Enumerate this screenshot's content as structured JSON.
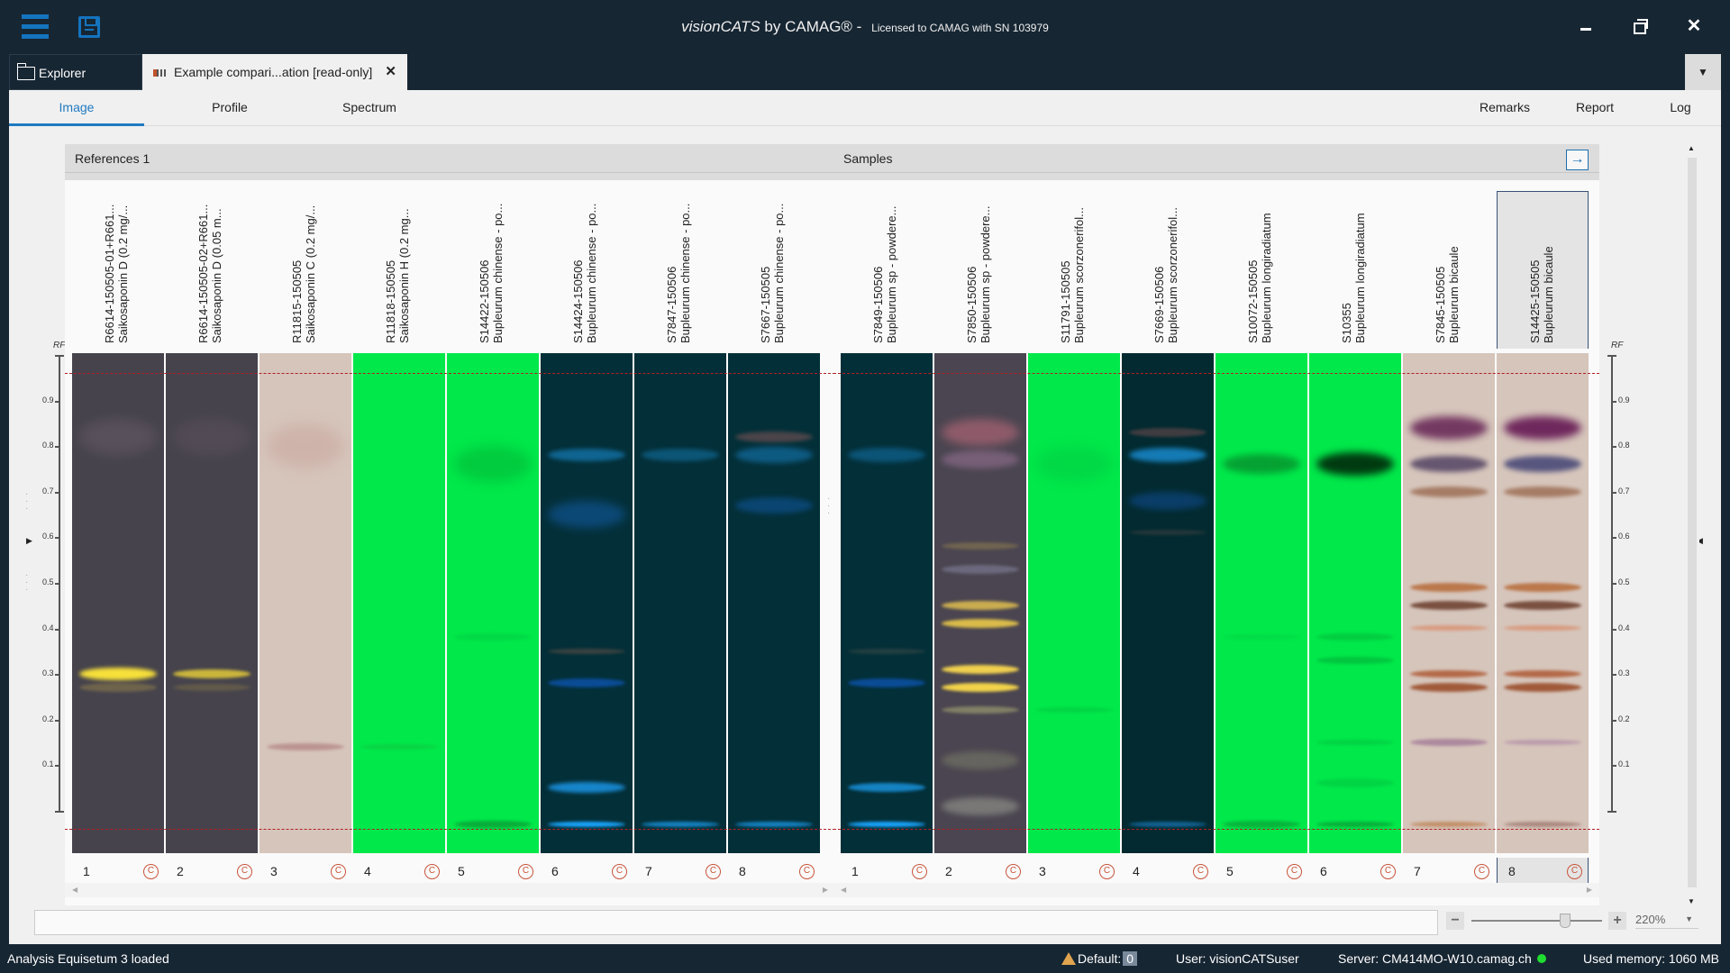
{
  "titlebar": {
    "brand": "visionCATS",
    "by": " by CAMAG®",
    "separator": " - ",
    "license": "Licensed to CAMAG with SN 103979"
  },
  "doc_tabs": {
    "explorer": "Explorer",
    "document": "Example compari...ation [read-only]",
    "close": "✕",
    "dropdown": "▼"
  },
  "view_tabs": {
    "left": [
      {
        "label": "Image",
        "active": true
      },
      {
        "label": "Profile",
        "active": false
      },
      {
        "label": "Spectrum",
        "active": false
      }
    ],
    "right": [
      {
        "label": "Remarks"
      },
      {
        "label": "Report"
      },
      {
        "label": "Log"
      }
    ]
  },
  "axis": {
    "rf_label": "RF",
    "ticks": [
      "0.9",
      "0.8",
      "0.7",
      "0.6",
      "0.5",
      "0.4",
      "0.3",
      "0.2",
      "0.1"
    ]
  },
  "references": {
    "title": "References 1",
    "tracks": [
      {
        "number": "1",
        "line1": "R6614-150505-01+R661...",
        "line2": "Saikosaponin D (0.2 mg/...",
        "bg": "#46434c",
        "bands": [
          {
            "rf": 0.34,
            "color": "#f7e03a",
            "h": 14,
            "o": 1
          },
          {
            "rf": 0.31,
            "color": "#8a7a4c",
            "h": 10,
            "o": 0.6
          },
          {
            "rf": 0.86,
            "color": "#6a5d6a",
            "h": 40,
            "o": 0.5
          }
        ]
      },
      {
        "number": "2",
        "line1": "R6614-150505-02+R661...",
        "line2": "Saikosaponin D (0.05 m...",
        "bg": "#46434c",
        "bands": [
          {
            "rf": 0.34,
            "color": "#d9c23a",
            "h": 10,
            "o": 0.9
          },
          {
            "rf": 0.31,
            "color": "#7d7048",
            "h": 8,
            "o": 0.5
          },
          {
            "rf": 0.86,
            "color": "#5e5360",
            "h": 40,
            "o": 0.5
          }
        ]
      },
      {
        "number": "3",
        "line1": "R11815-150505",
        "line2": "Saikosaponin C (0.2 mg/...",
        "bg": "#d6c5bb",
        "bands": [
          {
            "rf": 0.18,
            "color": "#b88f8c",
            "h": 8,
            "o": 0.9
          },
          {
            "rf": 0.84,
            "color": "#c9a8a0",
            "h": 50,
            "o": 0.6
          }
        ]
      },
      {
        "number": "4",
        "line1": "R11818-150505",
        "line2": "Saikosaponin H (0.2 mg...",
        "bg": "#00e84a",
        "bands": [
          {
            "rf": 0.18,
            "color": "#10c640",
            "h": 6,
            "o": 0.6
          }
        ]
      },
      {
        "number": "5",
        "line1": "S14422-150506",
        "line2": "Bupleurum chinense - po...",
        "bg": "#00e84a",
        "bands": [
          {
            "rf": 0.8,
            "color": "#02c43c",
            "h": 40,
            "o": 0.8
          },
          {
            "rf": 0.42,
            "color": "#02d043",
            "h": 8,
            "o": 0.6
          },
          {
            "rf": 0.01,
            "color": "#0a9e36",
            "h": 8,
            "o": 0.8
          }
        ]
      },
      {
        "number": "6",
        "line1": "S14424-150506",
        "line2": "Bupleurum chinense - po...",
        "bg": "#032f38",
        "bands": [
          {
            "rf": 0.82,
            "color": "#116a9a",
            "h": 14,
            "o": 0.9
          },
          {
            "rf": 0.69,
            "color": "#0e4f86",
            "h": 30,
            "o": 0.8
          },
          {
            "rf": 0.39,
            "color": "#514a44",
            "h": 6,
            "o": 0.7
          },
          {
            "rf": 0.32,
            "color": "#0b4fa0",
            "h": 10,
            "o": 0.9
          },
          {
            "rf": 0.09,
            "color": "#1785cb",
            "h": 12,
            "o": 1
          },
          {
            "rf": 0.01,
            "color": "#19a6ff",
            "h": 6,
            "o": 1
          }
        ]
      },
      {
        "number": "7",
        "line1": "S7847-150506",
        "line2": "Bupleurum chinense - po...",
        "bg": "#032f38",
        "bands": [
          {
            "rf": 0.82,
            "color": "#0f5f86",
            "h": 14,
            "o": 0.8
          },
          {
            "rf": 0.01,
            "color": "#1582c2",
            "h": 6,
            "o": 1
          }
        ]
      },
      {
        "number": "8",
        "line1": "S7667-150505",
        "line2": "Bupleurum chinense - po...",
        "bg": "#032f38",
        "bands": [
          {
            "rf": 0.86,
            "color": "#5d4a4e",
            "h": 12,
            "o": 0.8
          },
          {
            "rf": 0.82,
            "color": "#0f5f8a",
            "h": 18,
            "o": 0.9
          },
          {
            "rf": 0.71,
            "color": "#0c4b80",
            "h": 18,
            "o": 0.8
          },
          {
            "rf": 0.01,
            "color": "#1582c2",
            "h": 6,
            "o": 1
          }
        ]
      }
    ]
  },
  "samples": {
    "title": "Samples",
    "tracks": [
      {
        "number": "1",
        "line1": "S7849-150506",
        "line2": "Bupleurum sp - powdere...",
        "bg": "#032f38",
        "bands": [
          {
            "rf": 0.82,
            "color": "#0e5e88",
            "h": 16,
            "o": 0.8
          },
          {
            "rf": 0.39,
            "color": "#3a4a48",
            "h": 6,
            "o": 0.6
          },
          {
            "rf": 0.32,
            "color": "#0b4fa0",
            "h": 10,
            "o": 0.9
          },
          {
            "rf": 0.09,
            "color": "#1582c2",
            "h": 10,
            "o": 1
          },
          {
            "rf": 0.01,
            "color": "#19a6ff",
            "h": 6,
            "o": 1
          }
        ]
      },
      {
        "number": "2",
        "line1": "S7850-150506",
        "line2": "Bupleurum sp - powdere...",
        "bg": "#4a4550",
        "bands": [
          {
            "rf": 0.87,
            "color": "#a06070",
            "h": 30,
            "o": 0.8
          },
          {
            "rf": 0.81,
            "color": "#8a6a88",
            "h": 20,
            "o": 0.7
          },
          {
            "rf": 0.62,
            "color": "#8a7850",
            "h": 8,
            "o": 0.6
          },
          {
            "rf": 0.57,
            "color": "#7a7890",
            "h": 10,
            "o": 0.7
          },
          {
            "rf": 0.49,
            "color": "#d8b850",
            "h": 10,
            "o": 0.9
          },
          {
            "rf": 0.45,
            "color": "#e2c24a",
            "h": 10,
            "o": 0.95
          },
          {
            "rf": 0.35,
            "color": "#f0d04e",
            "h": 10,
            "o": 1
          },
          {
            "rf": 0.31,
            "color": "#f2d34a",
            "h": 10,
            "o": 1
          },
          {
            "rf": 0.26,
            "color": "#9a9a70",
            "h": 8,
            "o": 0.7
          },
          {
            "rf": 0.15,
            "color": "#7a7a68",
            "h": 20,
            "o": 0.6
          },
          {
            "rf": 0.05,
            "color": "#9a9a90",
            "h": 20,
            "o": 0.6
          }
        ]
      },
      {
        "number": "3",
        "line1": "S11791-150505",
        "line2": "Bupleurum scorzonerifol...",
        "bg": "#00e84a",
        "bands": [
          {
            "rf": 0.8,
            "color": "#02d043",
            "h": 40,
            "o": 0.6
          },
          {
            "rf": 0.26,
            "color": "#03c840",
            "h": 6,
            "o": 0.6
          }
        ]
      },
      {
        "number": "4",
        "line1": "S7669-150506",
        "line2": "Bupleurum scorzonerifol...",
        "bg": "#022a30",
        "bands": [
          {
            "rf": 0.87,
            "color": "#5a4548",
            "h": 10,
            "o": 0.7
          },
          {
            "rf": 0.82,
            "color": "#157bb5",
            "h": 16,
            "o": 1
          },
          {
            "rf": 0.72,
            "color": "#0c4275",
            "h": 20,
            "o": 0.8
          },
          {
            "rf": 0.65,
            "color": "#3a3f40",
            "h": 6,
            "o": 0.6
          },
          {
            "rf": 0.01,
            "color": "#156aa0",
            "h": 6,
            "o": 0.9
          }
        ]
      },
      {
        "number": "5",
        "line1": "S10072-150505",
        "line2": "Bupleurum longiradiatum",
        "bg": "#00e84a",
        "bands": [
          {
            "rf": 0.8,
            "color": "#069a30",
            "h": 22,
            "o": 0.9
          },
          {
            "rf": 0.42,
            "color": "#03d043",
            "h": 6,
            "o": 0.5
          },
          {
            "rf": 0.01,
            "color": "#0a9e36",
            "h": 8,
            "o": 0.7
          }
        ]
      },
      {
        "number": "6",
        "line1": "S10355",
        "line2": "Bupleurum longiradiatum",
        "bg": "#00e84a",
        "bands": [
          {
            "rf": 0.8,
            "color": "#003a10",
            "h": 26,
            "o": 1
          },
          {
            "rf": 0.42,
            "color": "#03c23e",
            "h": 8,
            "o": 0.7
          },
          {
            "rf": 0.37,
            "color": "#02b83a",
            "h": 8,
            "o": 0.7
          },
          {
            "rf": 0.19,
            "color": "#03c440",
            "h": 6,
            "o": 0.6
          },
          {
            "rf": 0.1,
            "color": "#03c842",
            "h": 10,
            "o": 0.6
          },
          {
            "rf": 0.01,
            "color": "#0a9e36",
            "h": 6,
            "o": 0.8
          }
        ]
      },
      {
        "number": "7",
        "line1": "S7845-150505",
        "line2": "Bupleurum bicaule",
        "bg": "#d6c5bb",
        "bands": [
          {
            "rf": 0.88,
            "color": "#6a2a58",
            "h": 26,
            "o": 0.9
          },
          {
            "rf": 0.8,
            "color": "#5a4a68",
            "h": 18,
            "o": 0.9
          },
          {
            "rf": 0.74,
            "color": "#9a6a50",
            "h": 12,
            "o": 0.8
          },
          {
            "rf": 0.53,
            "color": "#b87040",
            "h": 10,
            "o": 0.9
          },
          {
            "rf": 0.49,
            "color": "#7a5040",
            "h": 10,
            "o": 1
          },
          {
            "rf": 0.44,
            "color": "#d89070",
            "h": 6,
            "o": 0.8
          },
          {
            "rf": 0.34,
            "color": "#b0603c",
            "h": 8,
            "o": 0.9
          },
          {
            "rf": 0.31,
            "color": "#a05a3a",
            "h": 10,
            "o": 1
          },
          {
            "rf": 0.19,
            "color": "#a27a96",
            "h": 8,
            "o": 0.8
          },
          {
            "rf": 0.01,
            "color": "#c08a60",
            "h": 6,
            "o": 0.9
          }
        ]
      },
      {
        "number": "8",
        "line1": "S14425-150505",
        "line2": "Bupleurum bicaule",
        "bg": "#d6c5bb",
        "selected": true,
        "bands": [
          {
            "rf": 0.88,
            "color": "#6a2058",
            "h": 26,
            "o": 0.95
          },
          {
            "rf": 0.8,
            "color": "#4a4a78",
            "h": 18,
            "o": 0.9
          },
          {
            "rf": 0.74,
            "color": "#9a6a50",
            "h": 12,
            "o": 0.8
          },
          {
            "rf": 0.53,
            "color": "#b87040",
            "h": 10,
            "o": 0.9
          },
          {
            "rf": 0.49,
            "color": "#7a5040",
            "h": 10,
            "o": 1
          },
          {
            "rf": 0.44,
            "color": "#d89070",
            "h": 6,
            "o": 0.8
          },
          {
            "rf": 0.34,
            "color": "#b0603c",
            "h": 8,
            "o": 0.9
          },
          {
            "rf": 0.31,
            "color": "#a05a3a",
            "h": 10,
            "o": 1
          },
          {
            "rf": 0.19,
            "color": "#b08aa6",
            "h": 6,
            "o": 0.7
          },
          {
            "rf": 0.01,
            "color": "#a07a70",
            "h": 6,
            "o": 0.8
          }
        ]
      }
    ]
  },
  "zoom": {
    "minus": "−",
    "plus": "+",
    "value": "220%",
    "slider_fraction": 0.72
  },
  "bottom_input": {
    "value": ""
  },
  "statusbar": {
    "message": "Analysis Equisetum 3 loaded",
    "default_label": "Default:",
    "default_count": "0",
    "user": "User: visionCATSuser",
    "server": "Server: CM414MO-W10.camag.ch",
    "memory": "Used memory: 1060 MB"
  },
  "colors": {
    "accent": "#1f7ac0",
    "title_bg": "#172633",
    "rf_line": "#b21f24",
    "copyright_icon": "#c8543a",
    "server_status": "#1fdd30"
  }
}
